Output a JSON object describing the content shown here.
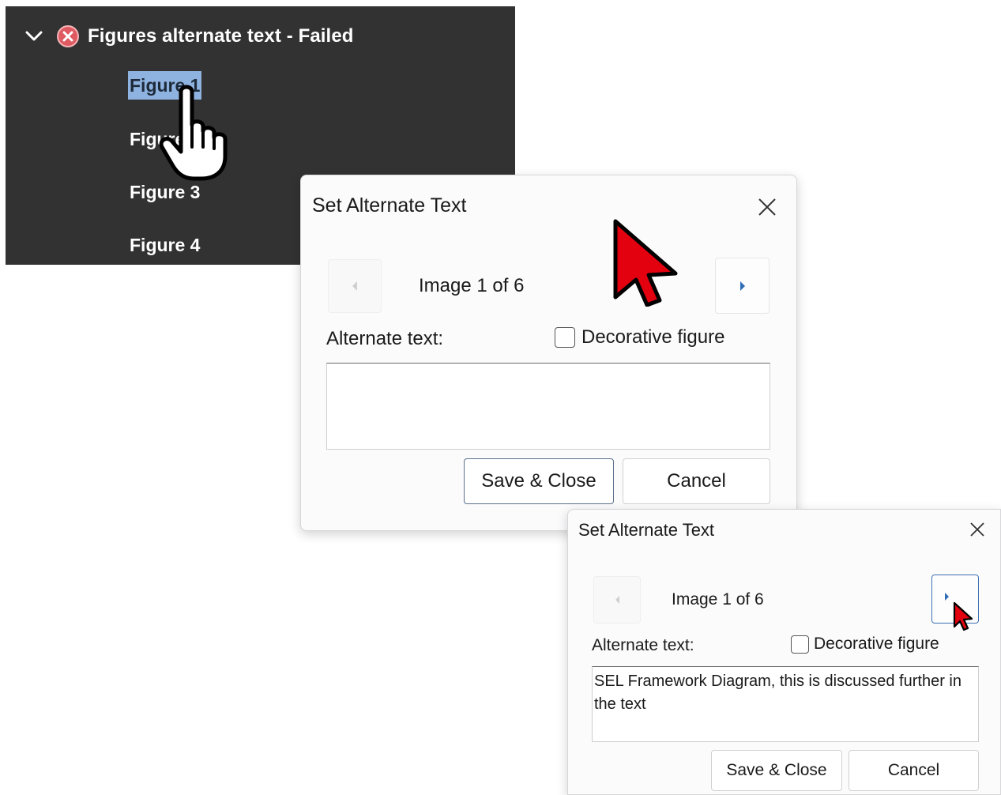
{
  "checker_panel": {
    "rule_label": "Figures alternate text - Failed",
    "status": "failed",
    "items": [
      {
        "label": "Figure 1",
        "selected": true
      },
      {
        "label": "Figure 2",
        "selected": false
      },
      {
        "label": "Figure 3",
        "selected": false
      },
      {
        "label": "Figure 4",
        "selected": false
      }
    ]
  },
  "dialog_first": {
    "title": "Set Alternate Text",
    "image_counter": "Image 1 of 6",
    "alt_text_label": "Alternate text:",
    "decorative_label": "Decorative figure",
    "decorative_checked": false,
    "alt_text_value": "",
    "save_label": "Save & Close",
    "cancel_label": "Cancel"
  },
  "dialog_second": {
    "title": "Set Alternate Text",
    "image_counter": "Image 1 of 6",
    "alt_text_label": "Alternate text:",
    "decorative_label": "Decorative figure",
    "decorative_checked": false,
    "alt_text_value": "SEL Framework Diagram, this is discussed further in the text",
    "save_label": "Save & Close",
    "cancel_label": "Cancel"
  },
  "colors": {
    "panel_background": "#323232",
    "selection_highlight": "#8fb3e0",
    "fail_icon": "#e05a62",
    "nav_arrow": "#2f6db5",
    "cursor_red": "#e3000f"
  },
  "icons": [
    "chevron-down-icon",
    "fail-icon",
    "hand-pointer-cursor",
    "close-icon",
    "arrow-left-icon",
    "arrow-right-icon",
    "arrow-cursor"
  ]
}
